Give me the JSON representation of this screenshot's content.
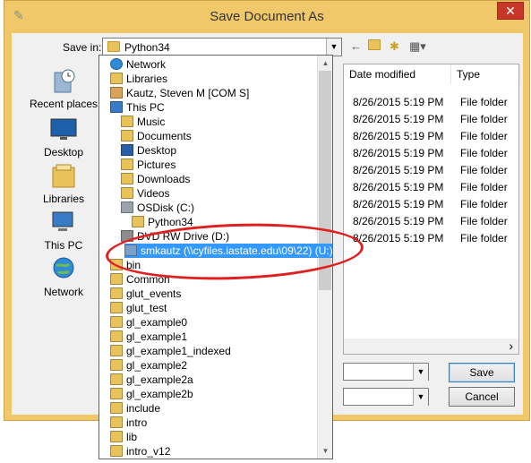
{
  "window": {
    "title": "Save Document As",
    "close_label": "✕"
  },
  "toolbar": {
    "save_in_label": "Save in:",
    "save_in_value": "Python34",
    "back_icon": "←",
    "up_icon": "📁",
    "new_folder_icon": "✱",
    "views_icon": "▦▾"
  },
  "places": [
    {
      "label": "Recent places",
      "icon": "recent-places-icon"
    },
    {
      "label": "Desktop",
      "icon": "desktop-icon"
    },
    {
      "label": "Libraries",
      "icon": "libraries-icon"
    },
    {
      "label": "This PC",
      "icon": "this-pc-icon"
    },
    {
      "label": "Network",
      "icon": "network-icon"
    }
  ],
  "filelist": {
    "columns": [
      "Date modified",
      "Type"
    ],
    "rows": [
      {
        "date": "8/26/2015 5:19 PM",
        "type": "File folder"
      },
      {
        "date": "8/26/2015 5:19 PM",
        "type": "File folder"
      },
      {
        "date": "8/26/2015 5:19 PM",
        "type": "File folder"
      },
      {
        "date": "8/26/2015 5:19 PM",
        "type": "File folder"
      },
      {
        "date": "8/26/2015 5:19 PM",
        "type": "File folder"
      },
      {
        "date": "8/26/2015 5:19 PM",
        "type": "File folder"
      },
      {
        "date": "8/26/2015 5:19 PM",
        "type": "File folder"
      },
      {
        "date": "8/26/2015 5:19 PM",
        "type": "File folder"
      },
      {
        "date": "8/26/2015 5:19 PM",
        "type": "File folder"
      }
    ],
    "scroll_right_icon": "›"
  },
  "buttons": {
    "save": "Save",
    "cancel": "Cancel"
  },
  "dropdown": {
    "items": [
      {
        "label": "Network",
        "icon": "network-icon",
        "indent": 0
      },
      {
        "label": "Libraries",
        "icon": "libraries-icon",
        "indent": 0
      },
      {
        "label": "Kautz, Steven M [COM S]",
        "icon": "user-icon",
        "indent": 0
      },
      {
        "label": "This PC",
        "icon": "this-pc-icon",
        "indent": 0
      },
      {
        "label": "Music",
        "icon": "music-folder-icon",
        "indent": 1
      },
      {
        "label": "Documents",
        "icon": "documents-folder-icon",
        "indent": 1
      },
      {
        "label": "Desktop",
        "icon": "desktop-folder-icon",
        "indent": 1
      },
      {
        "label": "Pictures",
        "icon": "pictures-folder-icon",
        "indent": 1
      },
      {
        "label": "Downloads",
        "icon": "downloads-folder-icon",
        "indent": 1
      },
      {
        "label": "Videos",
        "icon": "videos-folder-icon",
        "indent": 1
      },
      {
        "label": "OSDisk (C:)",
        "icon": "drive-icon",
        "indent": 1
      },
      {
        "label": "Python34",
        "icon": "folder-icon",
        "indent": 2
      },
      {
        "label": "DVD RW Drive (D:)",
        "icon": "dvd-drive-icon",
        "indent": 1
      },
      {
        "label": "smkautz (\\\\cyfiles.iastate.edu\\09\\22) (U:)",
        "icon": "network-drive-icon",
        "indent": 1,
        "selected": true
      },
      {
        "label": "bin",
        "icon": "folder-icon",
        "indent": 0
      },
      {
        "label": "Common",
        "icon": "folder-icon",
        "indent": 0
      },
      {
        "label": "glut_events",
        "icon": "folder-icon",
        "indent": 0
      },
      {
        "label": "glut_test",
        "icon": "folder-icon",
        "indent": 0
      },
      {
        "label": "gl_example0",
        "icon": "folder-icon",
        "indent": 0
      },
      {
        "label": "gl_example1",
        "icon": "folder-icon",
        "indent": 0
      },
      {
        "label": "gl_example1_indexed",
        "icon": "folder-icon",
        "indent": 0
      },
      {
        "label": "gl_example2",
        "icon": "folder-icon",
        "indent": 0
      },
      {
        "label": "gl_example2a",
        "icon": "folder-icon",
        "indent": 0
      },
      {
        "label": "gl_example2b",
        "icon": "folder-icon",
        "indent": 0
      },
      {
        "label": "include",
        "icon": "folder-icon",
        "indent": 0
      },
      {
        "label": "intro",
        "icon": "folder-icon",
        "indent": 0
      },
      {
        "label": "lib",
        "icon": "folder-icon",
        "indent": 0
      },
      {
        "label": "intro_v12",
        "icon": "folder-icon",
        "indent": 0
      }
    ]
  },
  "colors": {
    "title_bg": "#f0c86a",
    "close_bg": "#c7362b",
    "selection": "#3399ff",
    "annotation": "#e02020"
  }
}
